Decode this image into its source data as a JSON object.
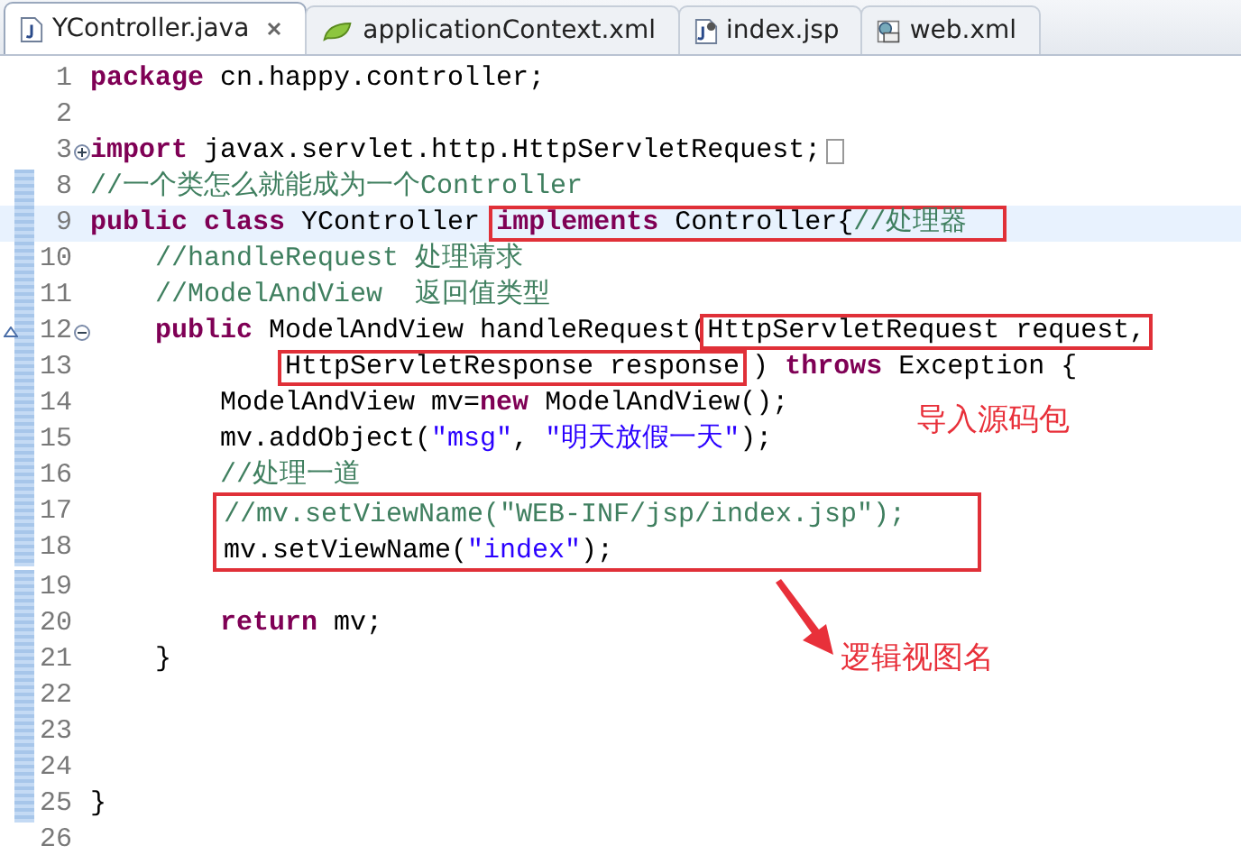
{
  "tabs": [
    {
      "label": "YController.java",
      "kind": "java",
      "selected": true
    },
    {
      "label": "applicationContext.xml",
      "kind": "spring",
      "selected": false
    },
    {
      "label": "index.jsp",
      "kind": "jsp",
      "selected": false
    },
    {
      "label": "web.xml",
      "kind": "xml",
      "selected": false
    }
  ],
  "lines": [
    {
      "kind": "line",
      "number": "1",
      "current": false,
      "changed": false,
      "segments": [
        {
          "text": "package",
          "kind": "keyword"
        },
        {
          "text": " cn.happy.controller;",
          "kind": "plain"
        }
      ]
    },
    {
      "kind": "line",
      "number": "2",
      "current": false,
      "changed": false
    },
    {
      "kind": "folded_line",
      "number": "3",
      "current": false,
      "changed": false,
      "segments": [
        {
          "text": "import",
          "kind": "keyword"
        },
        {
          "text": " javax.servlet.http.HttpServletRequest;",
          "kind": "plain"
        }
      ]
    },
    {
      "kind": "line",
      "number": "8",
      "current": false,
      "changed": true,
      "segments": [
        {
          "text": "//一个类怎么就能成为一个Controller",
          "kind": "comment"
        }
      ]
    },
    {
      "kind": "line",
      "number": "9",
      "current": true,
      "changed": true,
      "segments": [
        {
          "text": "public class",
          "kind": "keyword"
        },
        {
          "text": " YController ",
          "kind": "plain"
        },
        {
          "kind": "box",
          "segments": [
            {
              "text": "implements",
              "kind": "keyword"
            },
            {
              "text": " Controller{",
              "kind": "plain"
            },
            {
              "text": "//处理器",
              "kind": "comment"
            }
          ]
        }
      ]
    },
    {
      "kind": "line",
      "number": "10",
      "current": false,
      "changed": true,
      "segments": [
        {
          "text": "    //handleRequest 处理请求",
          "kind": "comment"
        }
      ]
    },
    {
      "kind": "line",
      "number": "11",
      "current": false,
      "changed": true,
      "segments": [
        {
          "text": "    //ModelAndView  返回值类型",
          "kind": "comment"
        }
      ]
    },
    {
      "kind": "method_line",
      "number": "12",
      "current": false,
      "changed": true,
      "segments": [
        {
          "text": "    public",
          "kind": "keyword"
        },
        {
          "text": " ModelAndView handleRequest(",
          "kind": "plain"
        },
        {
          "kind": "box",
          "segments": [
            {
              "text": "HttpServletRequest request,",
              "kind": "plain"
            }
          ]
        }
      ]
    },
    {
      "kind": "continuation_line",
      "number": "13",
      "current": false,
      "changed": true,
      "segments": [
        {
          "kind": "box",
          "segments": [
            {
              "text": "HttpServletResponse response",
              "kind": "plain"
            }
          ]
        },
        {
          "text": ") ",
          "kind": "plain"
        },
        {
          "text": "throws",
          "kind": "keyword"
        },
        {
          "text": " Exception {",
          "kind": "plain"
        }
      ]
    },
    {
      "kind": "line",
      "number": "14",
      "current": false,
      "changed": true,
      "segments": [
        {
          "text": "        ModelAndView mv=",
          "kind": "plain"
        },
        {
          "text": "new",
          "kind": "keyword"
        },
        {
          "text": " ModelAndView();",
          "kind": "plain"
        }
      ]
    },
    {
      "kind": "line",
      "number": "15",
      "current": false,
      "changed": true,
      "segments": [
        {
          "text": "        mv.addObject(",
          "kind": "plain"
        },
        {
          "text": "\"msg\"",
          "kind": "string"
        },
        {
          "text": ", ",
          "kind": "plain"
        },
        {
          "text": "\"明天放假一天\"",
          "kind": "string"
        },
        {
          "text": ");",
          "kind": "plain"
        }
      ]
    },
    {
      "kind": "line",
      "number": "16",
      "current": false,
      "changed": true,
      "segments": [
        {
          "text": "        //处理一道",
          "kind": "comment"
        }
      ]
    },
    {
      "kind": "group",
      "lines": [
        {
          "kind": "line",
          "number": "17",
          "current": false,
          "changed": true,
          "segments": [
            {
              "text": "//mv.setViewName(\"WEB-INF/jsp/index.jsp\");",
              "kind": "comment"
            }
          ]
        },
        {
          "kind": "line",
          "number": "18",
          "current": false,
          "changed": true,
          "segments": [
            {
              "text": "mv.setViewName(",
              "kind": "plain"
            },
            {
              "text": "\"index\"",
              "kind": "string"
            },
            {
              "text": ");",
              "kind": "plain"
            }
          ]
        }
      ]
    },
    {
      "kind": "line",
      "number": "19",
      "current": false,
      "changed": true
    },
    {
      "kind": "line",
      "number": "20",
      "current": false,
      "changed": true,
      "segments": [
        {
          "text": "        return",
          "kind": "keyword"
        },
        {
          "text": " mv;",
          "kind": "plain"
        }
      ]
    },
    {
      "kind": "line",
      "number": "21",
      "current": false,
      "changed": true,
      "segments": [
        {
          "text": "    }",
          "kind": "plain"
        }
      ]
    },
    {
      "kind": "line",
      "number": "22",
      "current": false,
      "changed": true
    },
    {
      "kind": "line",
      "number": "23",
      "current": false,
      "changed": true
    },
    {
      "kind": "line",
      "number": "24",
      "current": false,
      "changed": true
    },
    {
      "kind": "line",
      "number": "25",
      "current": false,
      "changed": true,
      "segments": [
        {
          "text": "}",
          "kind": "plain"
        }
      ]
    },
    {
      "kind": "line",
      "number": "26",
      "current": false,
      "changed": false
    }
  ],
  "annotations": [
    {
      "text": "导入源码包",
      "kind": "note"
    },
    {
      "text": "逻辑视图名",
      "kind": "arrow_note"
    }
  ]
}
